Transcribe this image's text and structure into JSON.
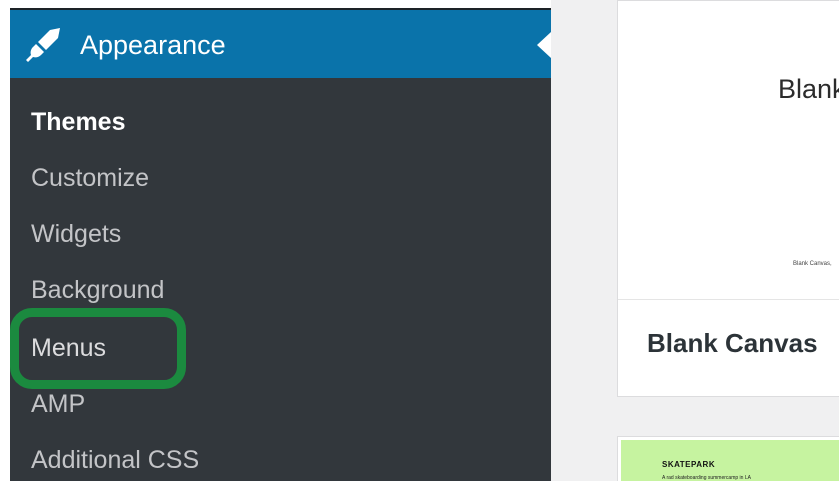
{
  "menu": {
    "section_label": "Appearance",
    "section_icon": "paintbrush-icon",
    "items": [
      {
        "label": "Themes",
        "current": true
      },
      {
        "label": "Customize"
      },
      {
        "label": "Widgets"
      },
      {
        "label": "Background"
      },
      {
        "label": "Menus",
        "highlighted": true
      },
      {
        "label": "AMP"
      },
      {
        "label": "Additional CSS"
      }
    ]
  },
  "themes": [
    {
      "preview_title": "Blank",
      "preview_caption": "Blank Canvas,",
      "name": "Blank Canvas"
    },
    {
      "preview_title": "SKATEPARK",
      "preview_tagline": "A rad skateboarding summercamp in LA"
    }
  ],
  "colors": {
    "admin_blue": "#0a73aa",
    "sidebar_bg": "#32373c",
    "highlight_green": "#1b8a3f",
    "skatepark_green": "#c6f3a0"
  }
}
